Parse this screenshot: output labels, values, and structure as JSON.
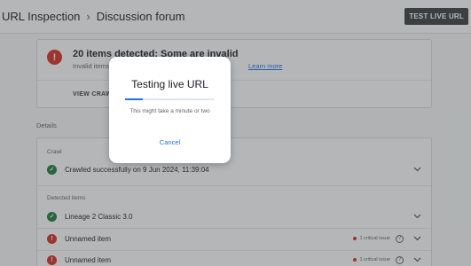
{
  "header": {
    "breadcrumb": [
      "URL Inspection",
      "Discussion forum"
    ],
    "separator": "›",
    "test_live_button": "TEST LIVE URL"
  },
  "summary": {
    "title": "20 items detected: Some are invalid",
    "description": "Invalid items",
    "description_tail": "ts. Learn more",
    "learn_more": "Learn more",
    "view_crawled": "VIEW CRAWL"
  },
  "details": {
    "label": "Details",
    "crawl_section": "Crawl",
    "crawl_status": "Crawled successfully on 9 Jun 2024, 11:39:04",
    "detected_section": "Detected items",
    "items": [
      {
        "name": "Lineage 2 Classic 3.0",
        "status": "valid",
        "issue": ""
      },
      {
        "name": "Unnamed item",
        "status": "invalid",
        "issue": "1 critical issue"
      },
      {
        "name": "Unnamed item",
        "status": "invalid",
        "issue": "1 critical issue"
      }
    ]
  },
  "dialog": {
    "title": "Testing live URL",
    "subtitle": "This might take a minute or two",
    "cancel": "Cancel",
    "progress": 0.2
  },
  "colors": {
    "accent": "#1a73e8",
    "error": "#d93025",
    "success": "#188038",
    "button_dark": "#3c4043"
  }
}
